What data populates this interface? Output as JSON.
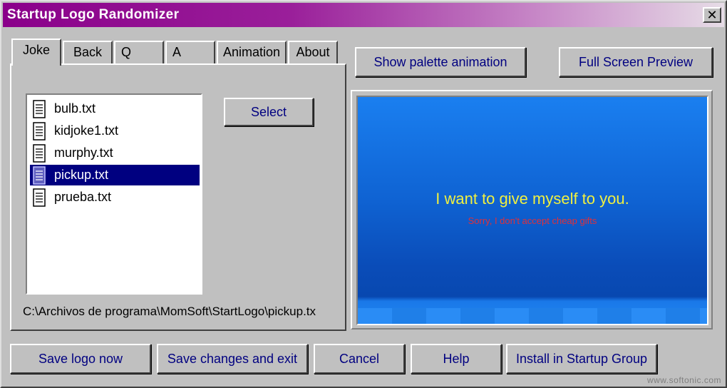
{
  "window": {
    "title": "Startup Logo Randomizer",
    "close_label": "✕"
  },
  "tabs": [
    {
      "label": "Joke",
      "active": true
    },
    {
      "label": "Back"
    },
    {
      "label": "Q"
    },
    {
      "label": "A"
    },
    {
      "label": "Animation"
    },
    {
      "label": "About"
    }
  ],
  "file_list": {
    "items": [
      "bulb.txt",
      "kidjoke1.txt",
      "murphy.txt",
      "pickup.txt",
      "prueba.txt"
    ],
    "selected": "pickup.txt"
  },
  "select_button": "Select",
  "current_path": "C:\\Archivos de programa\\MomSoft\\StartLogo\\pickup.tx",
  "top_buttons": {
    "palette": "Show palette animation",
    "fullscreen": "Full Screen Preview"
  },
  "preview": {
    "line1": "I want to give myself to you.",
    "line2": "Sorry, I don't accept cheap gifts",
    "line1_color": "#f0f040",
    "line2_color": "#e0303a"
  },
  "bottom_buttons": {
    "save_logo": "Save logo now",
    "save_exit": "Save changes and exit",
    "cancel": "Cancel",
    "help": "Help",
    "install": "Install in Startup Group"
  },
  "watermark": "www.softonic.com",
  "colors": {
    "title_bar": "#8a008a",
    "selection": "#000080",
    "face": "#c0c0c0"
  }
}
